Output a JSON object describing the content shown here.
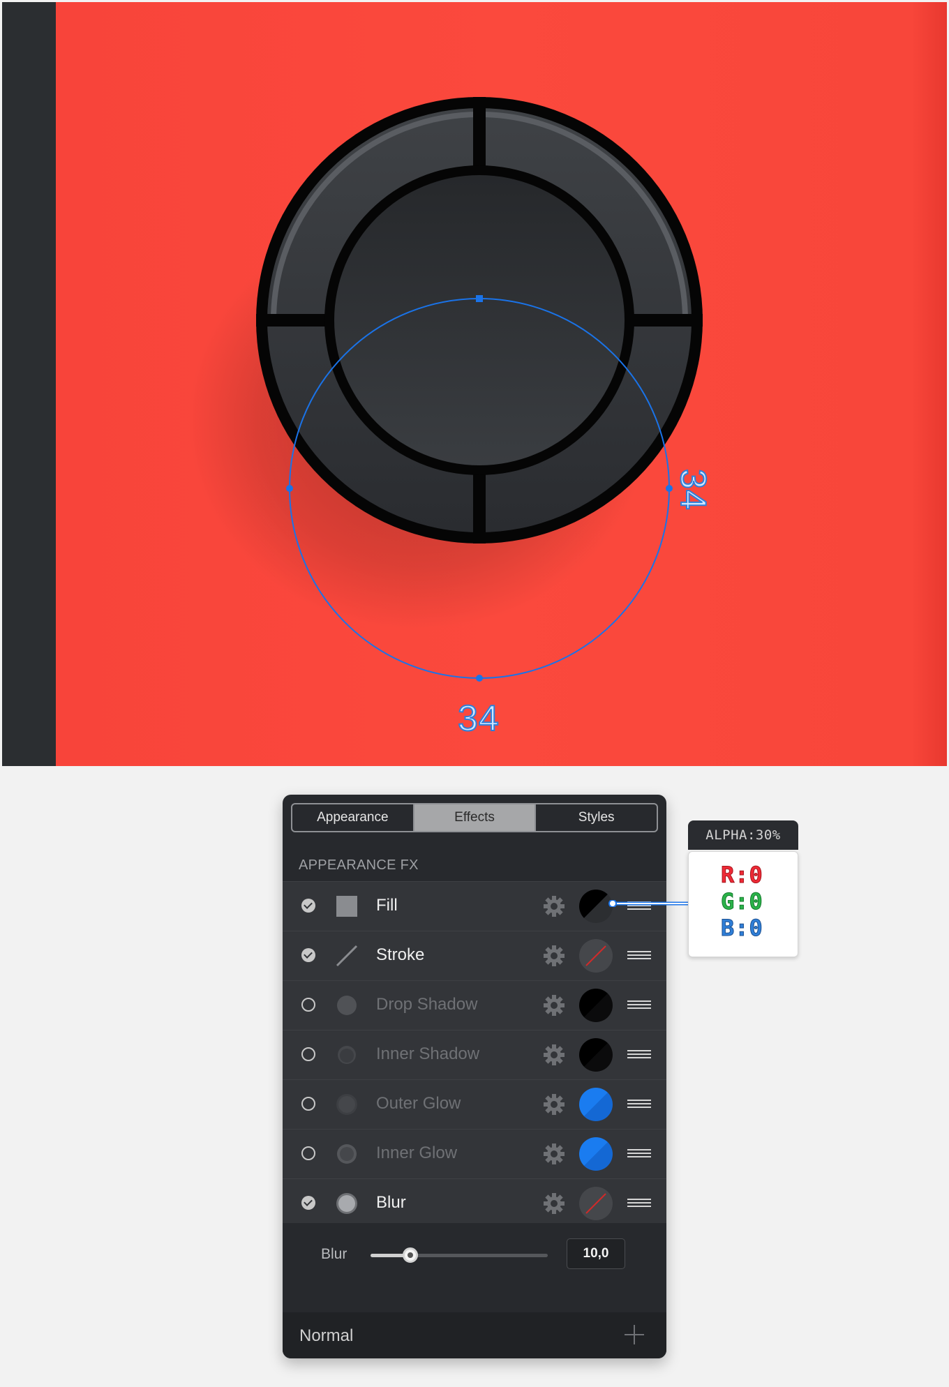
{
  "artwork": {
    "dimension_bottom": "34",
    "dimension_right": "34",
    "background_color": "#fb493d",
    "guide_color": "#1a73e8"
  },
  "panel": {
    "tabs": [
      {
        "label": "Appearance",
        "active": false
      },
      {
        "label": "Effects",
        "active": true
      },
      {
        "label": "Styles",
        "active": false
      }
    ],
    "section_title": "APPEARANCE FX",
    "effects": [
      {
        "label": "Fill",
        "enabled": true,
        "icon": "square-fill-icon",
        "swatch": "black-half"
      },
      {
        "label": "Stroke",
        "enabled": true,
        "icon": "stroke-line-icon",
        "swatch": "none"
      },
      {
        "label": "Drop Shadow",
        "enabled": false,
        "icon": "drop-shadow-icon",
        "swatch": "black"
      },
      {
        "label": "Inner Shadow",
        "enabled": false,
        "icon": "inner-shadow-icon",
        "swatch": "black"
      },
      {
        "label": "Outer Glow",
        "enabled": false,
        "icon": "outer-glow-icon",
        "swatch": "blue"
      },
      {
        "label": "Inner Glow",
        "enabled": false,
        "icon": "inner-glow-icon",
        "swatch": "blue"
      },
      {
        "label": "Blur",
        "enabled": true,
        "icon": "blur-icon",
        "swatch": "none"
      }
    ],
    "blur": {
      "label": "Blur",
      "value": "10,0",
      "slider_fraction": 0.2
    },
    "blend_mode": "Normal"
  },
  "callout": {
    "alpha": "ALPHA:30%",
    "r": "R:0",
    "g": "G:0",
    "b": "B:0"
  }
}
